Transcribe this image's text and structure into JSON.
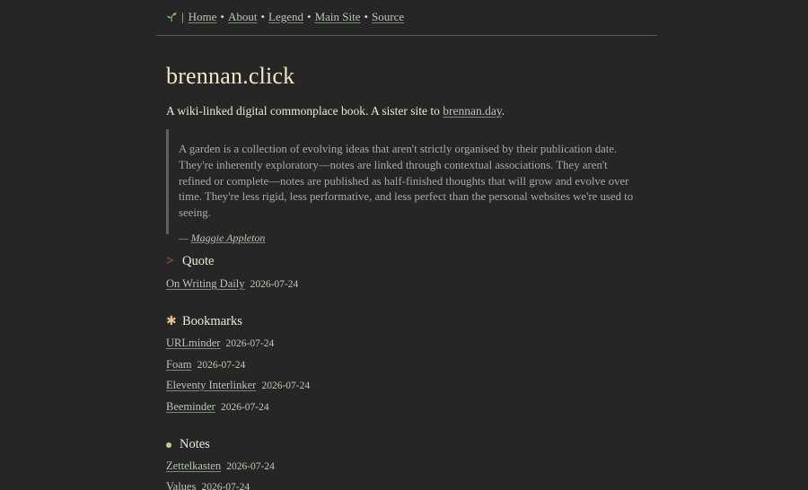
{
  "nav": {
    "separator": "|",
    "links": [
      "Home",
      "About",
      "Legend",
      "Main Site",
      "Source"
    ],
    "dot": "•"
  },
  "site": {
    "title": "brennan.click",
    "tagline_prefix": "A wiki-linked digital commonplace book. A sister site to ",
    "tagline_link": "brennan.day",
    "tagline_suffix": "."
  },
  "quote": {
    "text": "A garden is a collection of evolving ideas that aren't strictly organised by their publication date. They're inherently exploratory—notes are linked through contextual associations. They aren't refined or complete—notes are published as half-finished thoughts that will grow and evolve over time. They're less rigid, less performative, and less perfect than the personal websites we're used to seeing.",
    "cite_prefix": "— ",
    "cite_author": "Maggie Appleton"
  },
  "sections": {
    "quote": {
      "marker": ">",
      "title": "Quote",
      "items": [
        {
          "label": "On Writing Daily",
          "date": "2026-07-24"
        }
      ]
    },
    "bookmarks": {
      "marker": "✱",
      "title": "Bookmarks",
      "items": [
        {
          "label": "URLminder",
          "date": "2026-07-24"
        },
        {
          "label": "Foam",
          "date": "2026-07-24"
        },
        {
          "label": "Eleventy Interlinker",
          "date": "2026-07-24"
        },
        {
          "label": "Beeminder",
          "date": "2026-07-24"
        }
      ]
    },
    "notes": {
      "title": "Notes",
      "items": [
        {
          "label": "Zettelkasten",
          "date": "2026-07-24"
        },
        {
          "label": "Values",
          "date": "2026-07-24"
        }
      ]
    }
  },
  "icons": {
    "nav_logo": "sprout-icon"
  },
  "colors": {
    "background": "#262626",
    "title": "#f2e7c4",
    "link": "#b9c4b6",
    "quote_marker": "#e0624f",
    "bookmark_marker": "#e7c27a",
    "note_marker": "#c9c88a"
  }
}
